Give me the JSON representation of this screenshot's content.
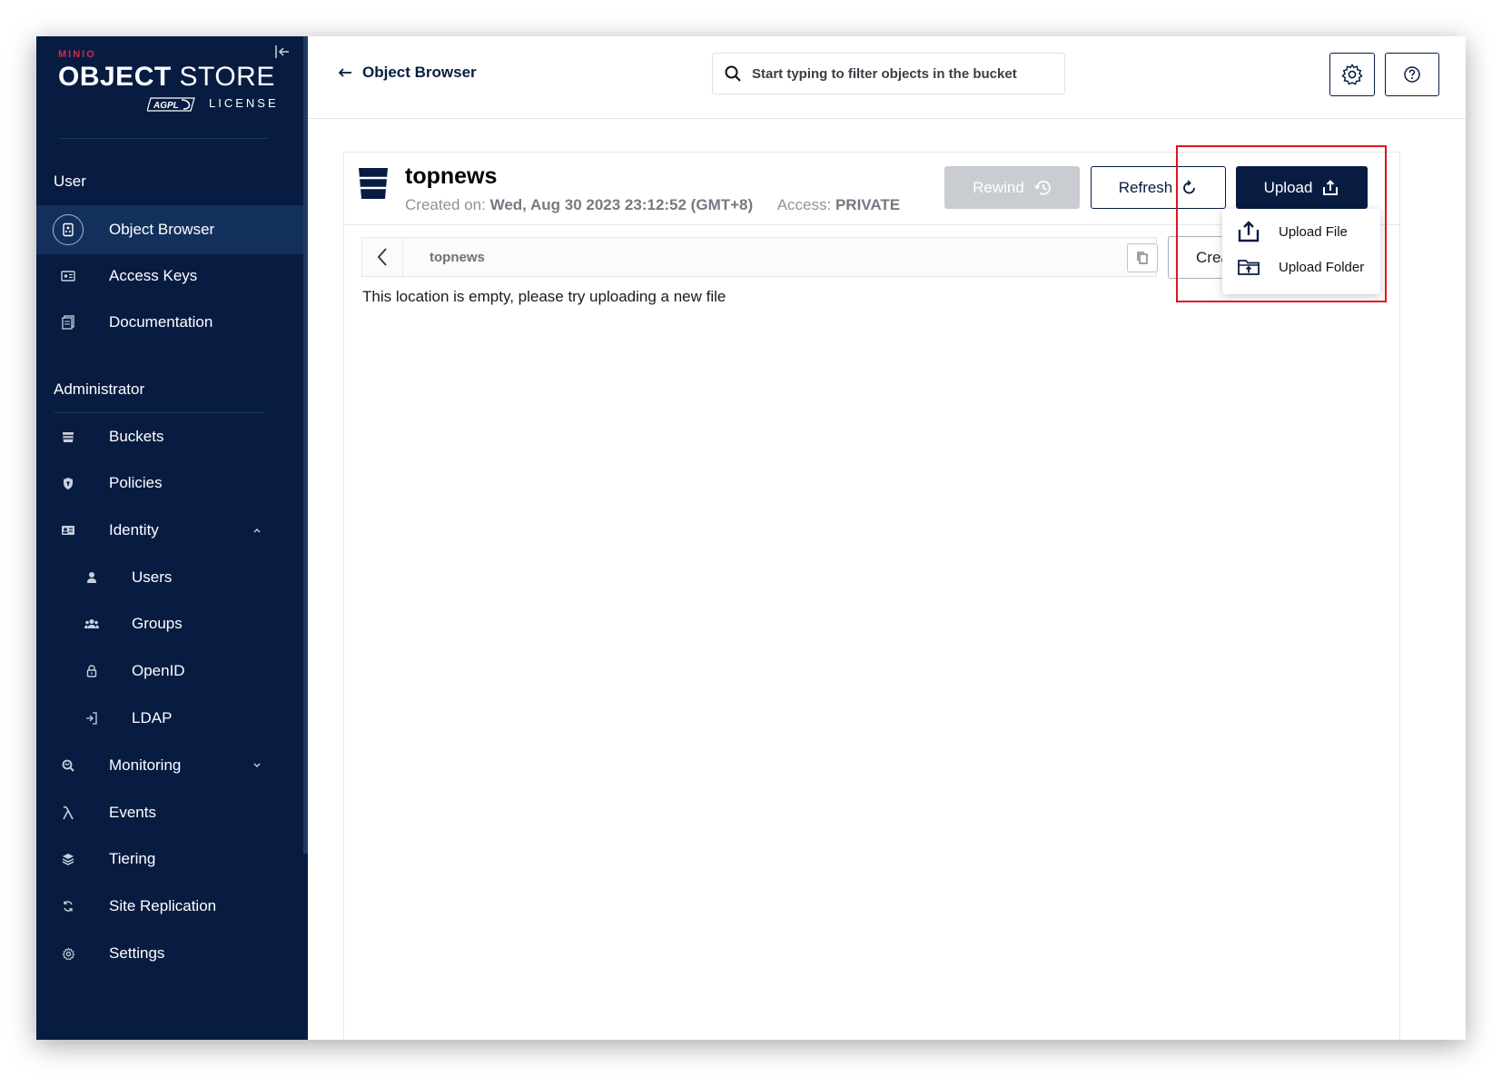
{
  "brand": {
    "minio": "MINIO",
    "title_bold": "OBJECT",
    "title_light": " STORE",
    "agpl": "AGPLv3",
    "license": "LICENSE"
  },
  "sidebar": {
    "user_section": "User",
    "user_items": [
      {
        "label": "Object Browser",
        "icon": "object-browser-icon",
        "active": true
      },
      {
        "label": "Access Keys",
        "icon": "access-keys-icon"
      },
      {
        "label": "Documentation",
        "icon": "documentation-icon"
      }
    ],
    "admin_section": "Administrator",
    "admin_items": [
      {
        "label": "Buckets",
        "icon": "bucket-icon"
      },
      {
        "label": "Policies",
        "icon": "shield-icon"
      },
      {
        "label": "Identity",
        "icon": "identity-card-icon",
        "expanded": true
      },
      {
        "label": "Users",
        "icon": "user-icon",
        "sub": true
      },
      {
        "label": "Groups",
        "icon": "group-icon",
        "sub": true
      },
      {
        "label": "OpenID",
        "icon": "lock-icon",
        "sub": true
      },
      {
        "label": "LDAP",
        "icon": "login-icon",
        "sub": true
      },
      {
        "label": "Monitoring",
        "icon": "magnifier-icon",
        "expanded": false
      },
      {
        "label": "Events",
        "icon": "lambda-icon"
      },
      {
        "label": "Tiering",
        "icon": "layers-icon"
      },
      {
        "label": "Site Replication",
        "icon": "sync-icon"
      },
      {
        "label": "Settings",
        "icon": "gear-icon"
      }
    ]
  },
  "header": {
    "back_label": "Object Browser",
    "search_placeholder": "Start typing to filter objects in the bucket"
  },
  "bucket": {
    "name": "topnews",
    "created_label": "Created on:",
    "created_value": "Wed, Aug 30 2023 23:12:52 (GMT+8)",
    "access_label": "Access:",
    "access_value": "PRIVATE"
  },
  "actions": {
    "rewind": "Rewind",
    "refresh": "Refresh",
    "upload": "Upload",
    "create": "Create"
  },
  "breadcrumb": {
    "path": "topnews"
  },
  "empty_message": "This location is empty, please try uploading a new file",
  "upload_menu": {
    "items": [
      {
        "label": "Upload File",
        "icon": "upload-file-icon"
      },
      {
        "label": "Upload Folder",
        "icon": "upload-folder-icon"
      }
    ]
  },
  "colors": {
    "sidebar_bg": "#081c42",
    "primary": "#081c42",
    "brand_red": "#c72c48",
    "highlight": "#e0141e"
  }
}
